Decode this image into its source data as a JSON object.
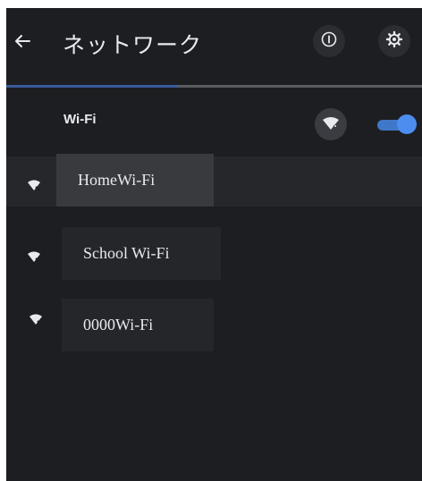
{
  "header": {
    "title": "ネットワーク"
  },
  "loading_progress": 0.41,
  "wifi": {
    "label": "Wi-Fi",
    "toggle_on": true
  },
  "networks": [
    {
      "name": "HomeWi-Fi",
      "selected": true
    },
    {
      "name": "School Wi-Fi",
      "selected": false
    },
    {
      "name": "0000Wi-Fi",
      "selected": false
    }
  ],
  "icons": {
    "back": "arrow-left",
    "info": "info-circle",
    "settings": "gear",
    "wifi_add": "wifi-signal",
    "network": "wifi-signal"
  },
  "colors": {
    "background": "#1d1e21",
    "accent": "#4d8df0",
    "text": "#e8eaed"
  }
}
